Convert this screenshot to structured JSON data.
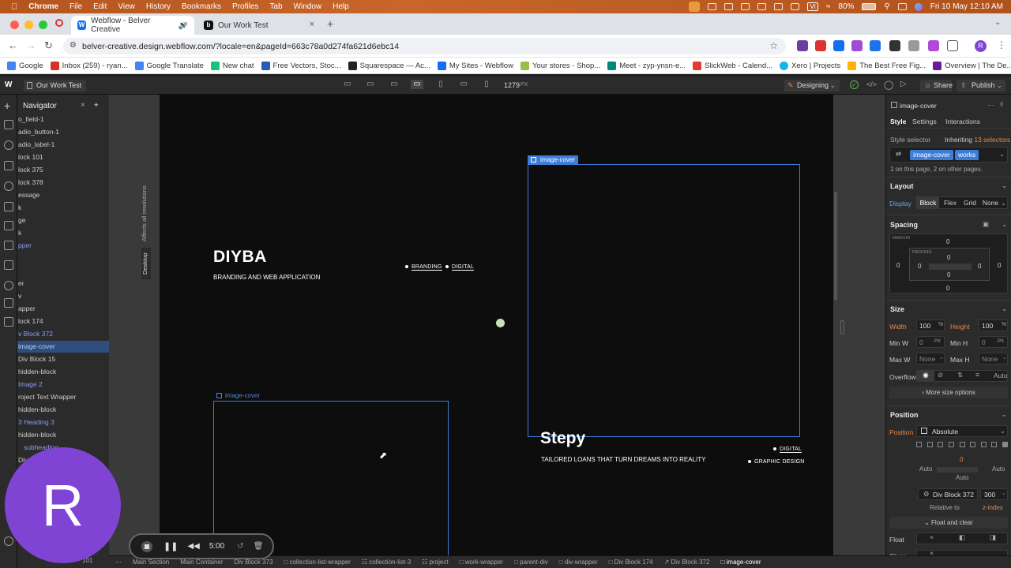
{
  "menubar": {
    "app": "Chrome",
    "items": [
      "File",
      "Edit",
      "View",
      "History",
      "Bookmarks",
      "Profiles",
      "Tab",
      "Window",
      "Help"
    ],
    "battery": "80%",
    "datetime": "Fri 10 May  12:10 AM",
    "ime": "VI"
  },
  "tabs": [
    {
      "title": "Webflow - Belver Creative",
      "favicon": "W"
    },
    {
      "title": "Our Work Test",
      "favicon": "b"
    }
  ],
  "omnibox": {
    "url": "belver-creative.design.webflow.com/?locale=en&pageId=663c78a0d274fa621d6ebc14"
  },
  "profile_initial": "R",
  "bookmarks": [
    {
      "label": "Google",
      "color": "#4285f4"
    },
    {
      "label": "Inbox (259) - ryan...",
      "color": "#d93025"
    },
    {
      "label": "Google Translate",
      "color": "#4285f4"
    },
    {
      "label": "New chat",
      "color": "#19c37d"
    },
    {
      "label": "Free Vectors, Stoc...",
      "color": "#2a5ab8"
    },
    {
      "label": "Squarespace — Ac...",
      "color": "#222222"
    },
    {
      "label": "My Sites - Webflow",
      "color": "#146ef5"
    },
    {
      "label": "Your stores - Shop...",
      "color": "#95bf47"
    },
    {
      "label": "Meet - zyp-ynsn-e...",
      "color": "#00897b"
    },
    {
      "label": "SlickWeb - Calend...",
      "color": "#e53935"
    },
    {
      "label": "Xero | Projects",
      "color": "#13b5ea"
    },
    {
      "label": "The Best Free Fig...",
      "color": "#ffb300"
    },
    {
      "label": "Overview | The De...",
      "color": "#6a1b9a"
    }
  ],
  "webflow_top": {
    "page": "Our Work Test",
    "width_value": "1279",
    "width_unit": "PX",
    "mode": "Designing",
    "share": "Share",
    "publish": "Publish"
  },
  "navigator": {
    "title": "Navigator",
    "rows": [
      {
        "label": "o_field-1"
      },
      {
        "label": "adio_button-1"
      },
      {
        "label": "adio_label-1"
      },
      {
        "label": "lock 101"
      },
      {
        "label": "lock 375"
      },
      {
        "label": "lock 378"
      },
      {
        "label": "essage"
      },
      {
        "label": "k"
      },
      {
        "label": "ge"
      },
      {
        "label": "k"
      },
      {
        "label": "pper"
      },
      {
        "label": ""
      },
      {
        "label": "er"
      },
      {
        "label": "v"
      },
      {
        "label": "apper"
      },
      {
        "label": "lock 174"
      },
      {
        "label": "v Block 372"
      },
      {
        "label": "image-cover"
      },
      {
        "label": "Div Block 15"
      },
      {
        "label": "hidden-block"
      },
      {
        "label": "Image 2"
      },
      {
        "label": "roject Text Wrapper"
      },
      {
        "label": "hidden-block"
      },
      {
        "label": "3  Heading 3"
      },
      {
        "label": "hidden-block"
      },
      {
        "label": "subheading"
      },
      {
        "label": "Div"
      }
    ]
  },
  "canvas": {
    "side_text_1": "Affects all resolutions",
    "side_text_2": "Desktop",
    "project1": {
      "title": "DIYBA",
      "subtitle": "BRANDING AND WEB APPLICATION",
      "tags": [
        "BRANDING",
        "DIGITAL"
      ]
    },
    "project2": {
      "title": "Stepy",
      "subtitle": "TAILORED LOANS THAT TURN DREAMS INTO REALITY",
      "tags": [
        "DIGITAL",
        "GRAPHIC DESIGN"
      ]
    },
    "selected_label": "image-cover",
    "hover_label": "image-cover"
  },
  "right_panel": {
    "element": "image-cover",
    "tabs": [
      "Style",
      "Settings",
      "Interactions"
    ],
    "style_selector_label": "Style selector",
    "inheriting_text": "Inheriting",
    "inheriting_count": "13 selectors",
    "classes": [
      "image-cover",
      "works"
    ],
    "usage": "1 on this page, 2 on other pages.",
    "layout": {
      "title": "Layout",
      "display_label": "Display",
      "options": [
        "Block",
        "Flex",
        "Grid",
        "None"
      ]
    },
    "spacing": {
      "title": "Spacing",
      "margin_label": "MARGIN",
      "padding_label": "PADDING",
      "zero": "0"
    },
    "size": {
      "title": "Size",
      "width_label": "Width",
      "width_value": "100",
      "width_unit": "%",
      "height_label": "Height",
      "height_value": "100",
      "height_unit": "%",
      "minw_label": "Min W",
      "minw_value": "0",
      "minw_unit": "PX",
      "minh_label": "Min H",
      "minh_value": "0",
      "minh_unit": "PX",
      "maxw_label": "Max W",
      "maxw_value": "None",
      "maxh_label": "Max H",
      "maxh_value": "None",
      "overflow_label": "Overflow",
      "overflow_auto": "Auto",
      "more": "More size options"
    },
    "position": {
      "title": "Position",
      "label": "Position",
      "value": "Absolute",
      "top_val": "0",
      "auto_left": "Auto",
      "auto_right": "Auto",
      "auto_bottom": "Auto",
      "relative_el": "Div Block 372",
      "z_value": "300",
      "relative_to": "Relative to",
      "z_index": "z-index",
      "float_clear": "Float and clear",
      "float_label": "Float",
      "clear_label": "Clear"
    }
  },
  "breadcrumbs": [
    "Main Section",
    "Main Container",
    "Div Block 373",
    "collection-list-wrapper",
    "collection-list-3",
    "project",
    "work-wrapper",
    "parent-div",
    "div-wrapper",
    "Div Block 174",
    "Div Block 372",
    "image-cover"
  ],
  "left_breadcrumb": "101",
  "recorder": {
    "time": "5:00",
    "avatar_letter": "R"
  }
}
